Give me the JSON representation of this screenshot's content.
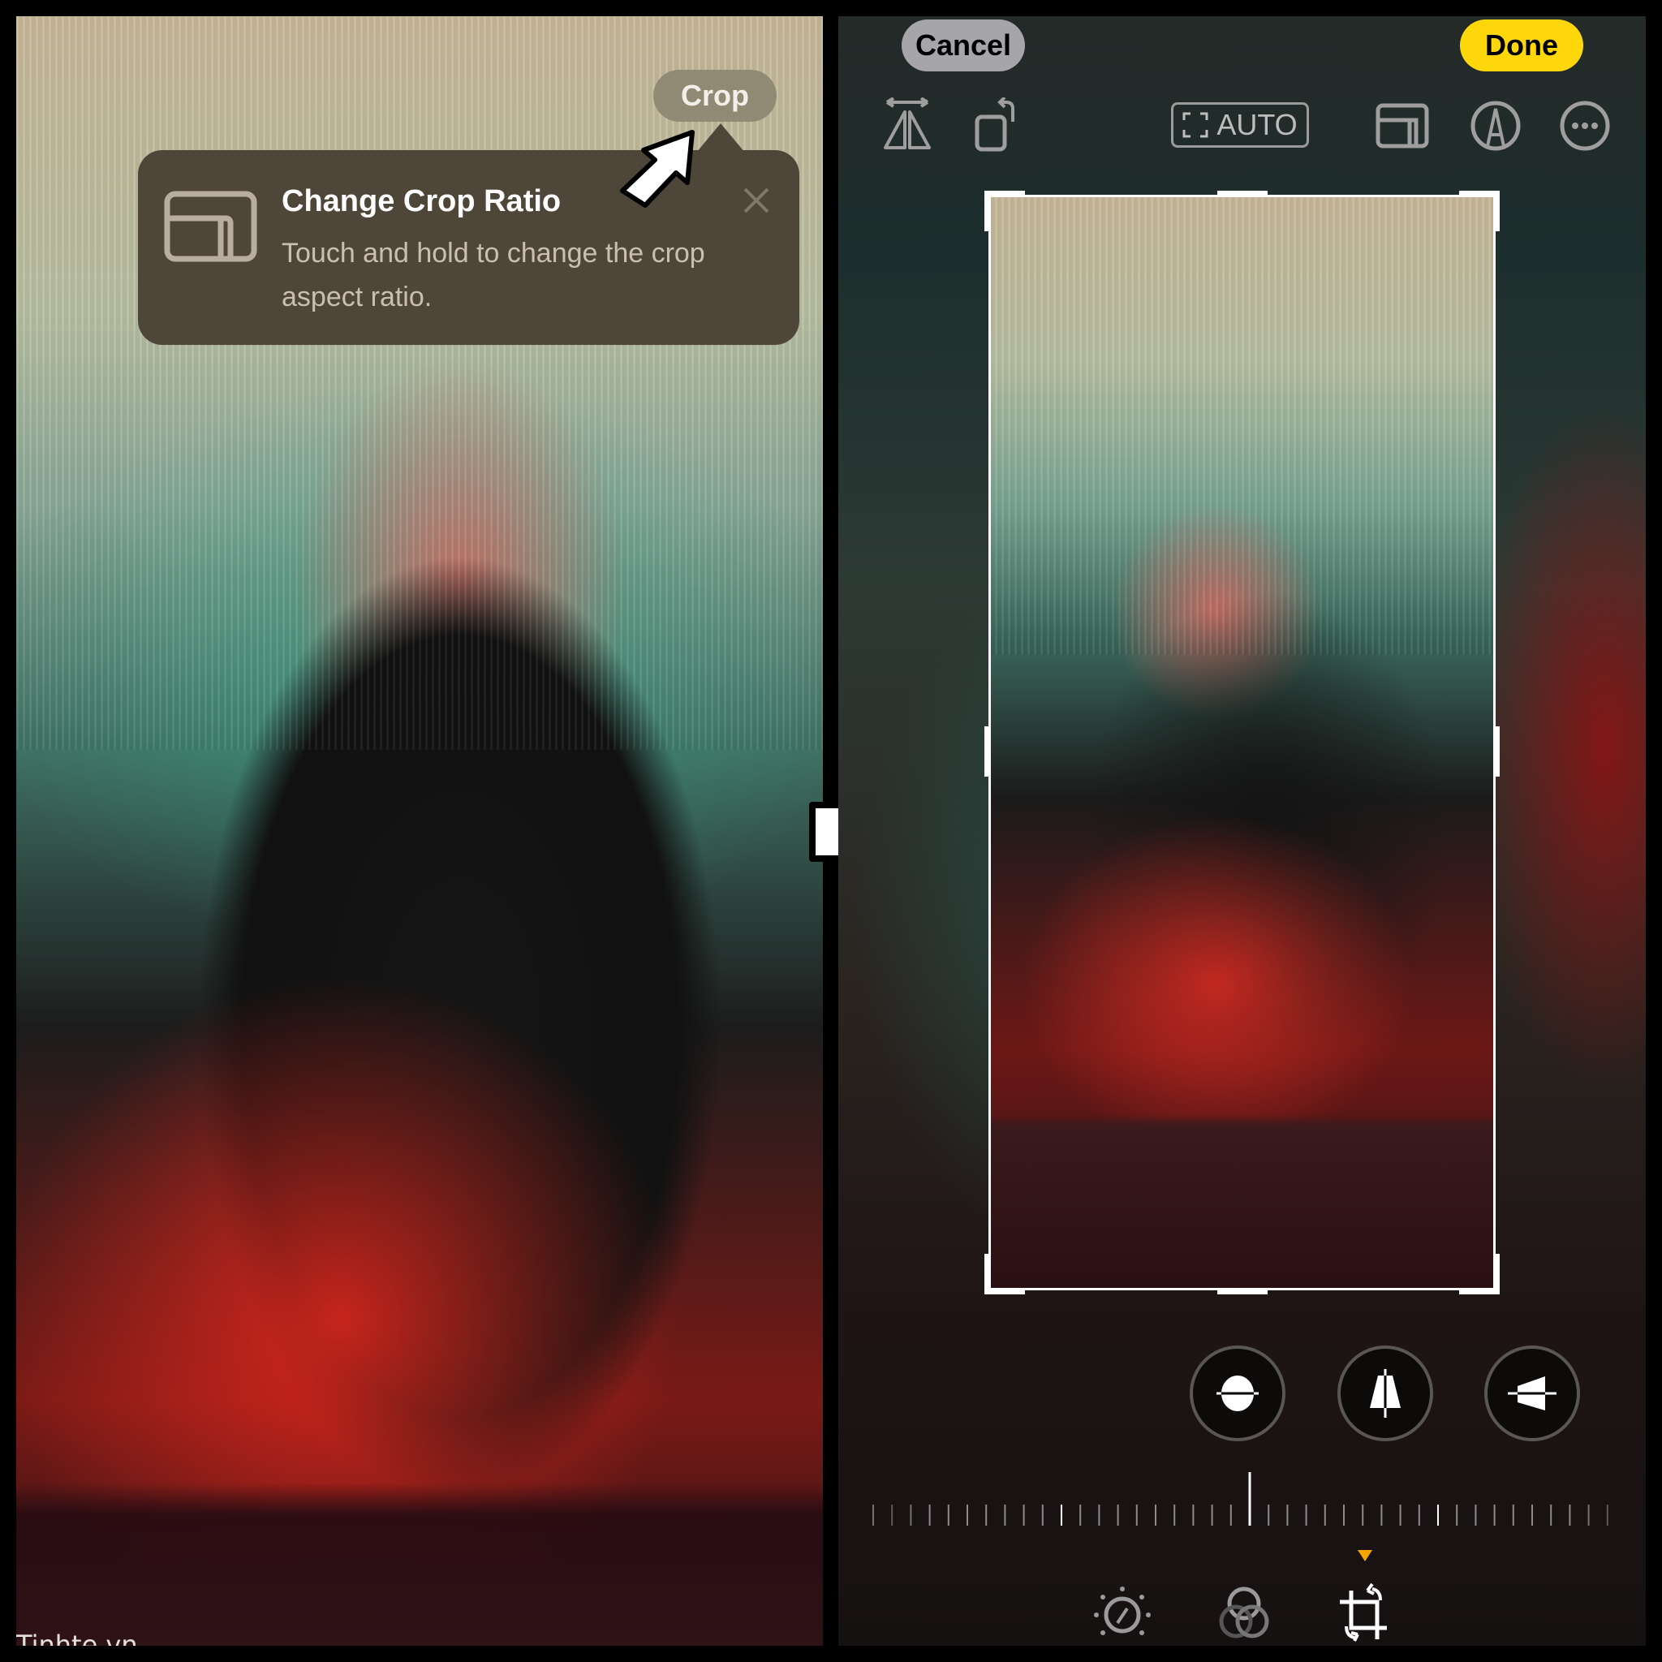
{
  "left_panel": {
    "crop_button_label": "Crop",
    "tooltip": {
      "icon": "aspect-ratio-icon",
      "title": "Change Crop Ratio",
      "body": "Touch and hold to change the crop aspect ratio.",
      "close_icon": "close-icon"
    },
    "annotation_arrow": "pointer-arrow",
    "watermark": "Tinhte.vn"
  },
  "transition_arrow": "right-arrow",
  "right_panel": {
    "header": {
      "cancel_label": "Cancel",
      "done_label": "Done"
    },
    "toolbar": {
      "flip_icon": "flip-horizontal-icon",
      "rotate_icon": "rotate-icon",
      "auto_label": "AUTO",
      "aspect_icon": "aspect-ratio-icon",
      "markup_icon": "markup-pen-icon",
      "more_icon": "more-icon"
    },
    "perspective_buttons": [
      {
        "name": "straighten",
        "icon": "straighten-icon"
      },
      {
        "name": "vertical",
        "icon": "vertical-perspective-icon"
      },
      {
        "name": "horizontal",
        "icon": "horizontal-perspective-icon"
      }
    ],
    "dial": {
      "value": 0,
      "selected": "straighten"
    },
    "bottom_tabs": [
      {
        "name": "adjust",
        "icon": "adjust-dial-icon",
        "active": false
      },
      {
        "name": "filters",
        "icon": "filters-icon",
        "active": false
      },
      {
        "name": "crop",
        "icon": "crop-rotate-icon",
        "active": true
      }
    ],
    "colors": {
      "done": "#fed70a",
      "cancel": "#a6a6aa",
      "active_marker": "#f7a500"
    }
  }
}
